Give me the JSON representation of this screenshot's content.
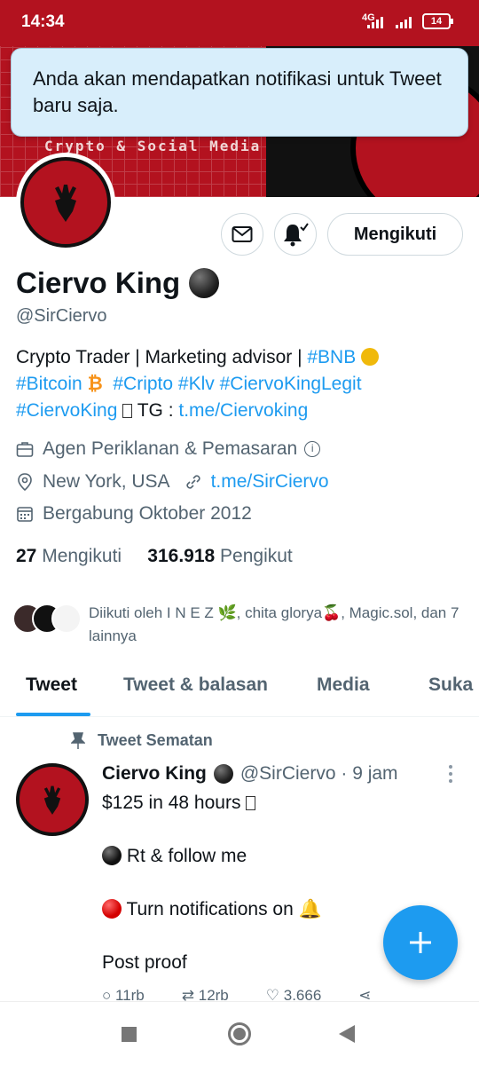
{
  "status_bar": {
    "time": "14:34",
    "network": "4G",
    "battery": "14"
  },
  "banner": {
    "text": "Crypto & Social Media"
  },
  "toast": {
    "message": "Anda akan mendapatkan notifikasi untuk Tweet baru saja."
  },
  "profile": {
    "name": "Ciervo King",
    "handle": "@SirCiervo",
    "follow_button": "Mengikuti",
    "bio": {
      "line1_text": "Crypto Trader | Marketing advisor | ",
      "tag_bnb": "#BNB",
      "tag_bitcoin": "#Bitcoin",
      "btc_symbol": "₿",
      "tag_cripto": "#Cripto",
      "tag_klv": "#Klv",
      "tag_legit": "#CiervoKingLegit",
      "tag_ciervoking": "#CiervoKing",
      "tg_label": " TG : ",
      "tg_link": "t.me/Ciervoking"
    },
    "category": "Agen Periklanan & Pemasaran",
    "location": "New York, USA",
    "website": "t.me/SirCiervo",
    "joined": "Bergabung Oktober 2012",
    "following_count": "27",
    "following_label": "Mengikuti",
    "followers_count": "316.918",
    "followers_label": "Pengikut",
    "followed_by": "Diikuti oleh I N E Z 🌿, chita glorya🍒, Magic.sol, dan 7 lainnya"
  },
  "tabs": [
    {
      "label": "Tweet",
      "active": true
    },
    {
      "label": "Tweet & balasan",
      "active": false
    },
    {
      "label": "Media",
      "active": false
    },
    {
      "label": "Suka",
      "active": false
    }
  ],
  "tweet": {
    "pinned_label": "Tweet Sematan",
    "author": "Ciervo King",
    "handle_time": "@SirCiervo · 9 jam",
    "line1": "$125 in 48 hours ",
    "line2": " Rt & follow me",
    "line3": " Turn notifications on 🔔",
    "line4": " Post proof",
    "replies": "11rb",
    "retweets": "12rb",
    "likes": "3.666"
  },
  "colors": {
    "brand_red": "#b3121f",
    "accent_blue": "#1d9bf0"
  }
}
